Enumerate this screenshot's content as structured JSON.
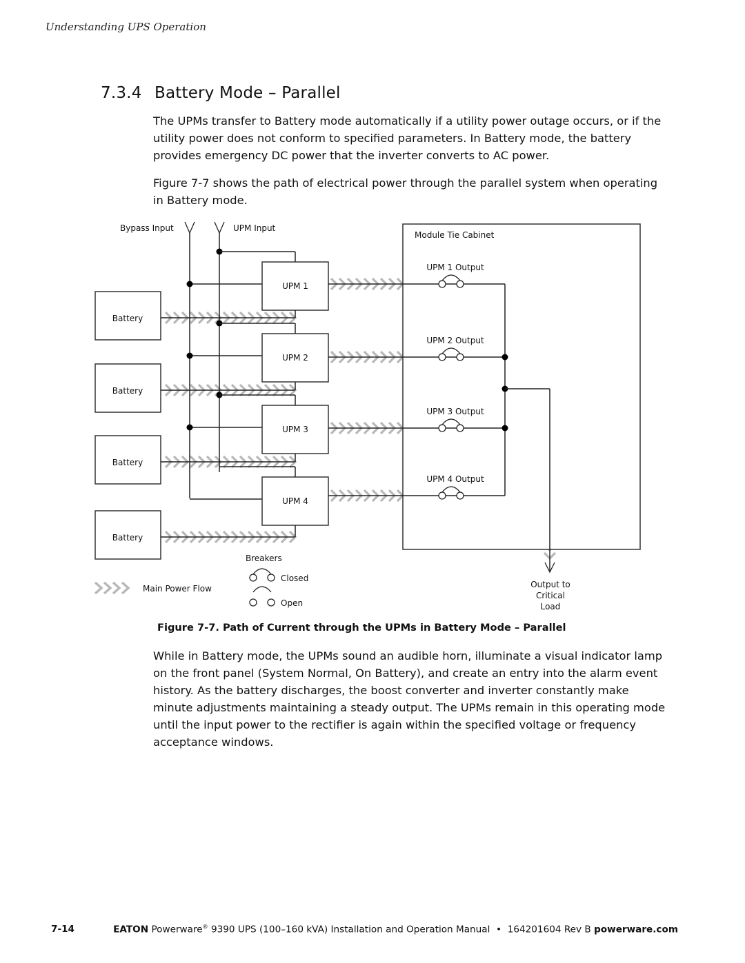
{
  "header": {
    "running_head": "Understanding UPS Operation"
  },
  "section": {
    "number": "7.3.4",
    "title": "Battery Mode – Parallel"
  },
  "body": {
    "paragraph_1": "The UPMs transfer to Battery mode automatically if a utility power outage occurs, or if the utility power does not conform to specified parameters. In Battery mode, the battery provides emergency DC power that the inverter converts to AC power.",
    "paragraph_2": "Figure 7-7 shows the path of electrical power through the parallel system when operating in Battery mode.",
    "paragraph_3": "While in Battery mode, the UPMs sound an audible horn, illuminate a visual indicator lamp on the front panel (System Normal, On Battery), and create an entry into the alarm event history. As the battery discharges, the boost converter and inverter constantly make minute adjustments maintaining a steady output. The UPMs remain in this operating mode until the input power to the rectifier is again within the specified voltage or frequency acceptance windows."
  },
  "figure": {
    "caption": "Figure 7-7. Path of Current through the UPMs in Battery Mode – Parallel",
    "labels": {
      "bypass_input": "Bypass Input",
      "upm_input": "UPM Input",
      "module_tie_cabinet": "Module Tie Cabinet",
      "output_line1": "Output to",
      "output_line2": "Critical",
      "output_line3": "Load",
      "breakers": "Breakers",
      "closed": "Closed",
      "open": "Open",
      "main_power_flow": "Main Power Flow"
    },
    "upms": [
      {
        "label": "UPM 1",
        "output_label": "UPM 1 Output",
        "battery_label": "Battery"
      },
      {
        "label": "UPM 2",
        "output_label": "UPM 2 Output",
        "battery_label": "Battery"
      },
      {
        "label": "UPM 3",
        "output_label": "UPM 3 Output",
        "battery_label": "Battery"
      },
      {
        "label": "UPM 4",
        "output_label": "UPM 4 Output",
        "battery_label": "Battery"
      }
    ],
    "colors": {
      "line": "#222222",
      "flow": "#b8b8b8",
      "box": "#333333"
    }
  },
  "footer": {
    "page_number": "7-14",
    "brand": "EATON",
    "product": "Powerware",
    "registered": "®",
    "title_rest": " 9390 UPS (100–160 kVA) Installation and Operation Manual  •  164201604 Rev B ",
    "website": "powerware.com"
  }
}
